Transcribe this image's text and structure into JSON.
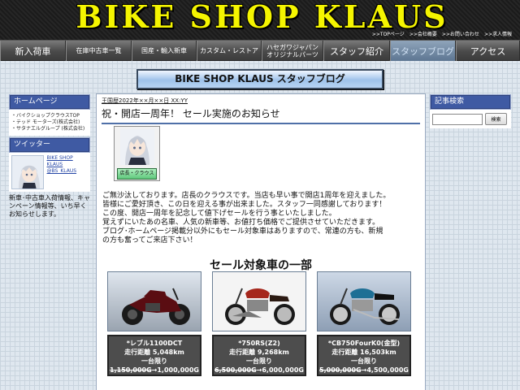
{
  "header": {
    "site_title": "BIKE SHOP KLAUS",
    "util_links": [
      ">>TOPページ",
      ">>会社概要",
      ">>お問い合わせ",
      ">>求人情報"
    ]
  },
  "nav": {
    "items": [
      "新入荷車",
      "在庫中古車一覧",
      "国産・輸入新車",
      "カスタム・レストア",
      "ハセガワジャパン\nオリジナルパーツ",
      "スタッフ紹介",
      "スタッフブログ",
      "アクセス"
    ],
    "active_index": 6
  },
  "page_heading": "BIKE SHOP KLAUS スタッフブログ",
  "left_sidebar": {
    "home_title": "ホームページ",
    "home_links": [
      "・バイクショップクラウスTOP",
      "・テッド モーターズ(株式会社)",
      "・サタナエルグループ (株式会社)"
    ],
    "twitter_title": "ツイッター",
    "twitter_name": "BIKE SHOP KLAUS",
    "twitter_handle": "@BS_KLAUS",
    "description": "新車･中古車入荷情報、キャンペーン情報等、いち早くお知らせします。"
  },
  "right_sidebar": {
    "search_title": "記事検索",
    "search_value": "",
    "search_button": "検索"
  },
  "post": {
    "date": "王国歴2022年××月××日 XX:YY",
    "title": "祝・開店一周年！ セール実施のお知らせ",
    "author_label": "店長・クラウス",
    "body": [
      "ご無沙汰しております。店長のクラウスです。当店も早い事で開店1周年を迎えました。",
      "皆様にご愛好頂き、この日を迎える事が出来ました。スタッフ一同感謝しております！",
      "この度、開店一周年を記念して値下げセールを行う事といたしました。",
      "覚えずにいたあの名車、人気の新車等、お値打ち価格でご提供させていただきます。",
      "ブログ･ホームページ掲載分以外にもセール対象車はありますので、常連の方も、新規",
      "の方も奮ってご来店下さい！"
    ],
    "sale_title": "セール対象車の一部",
    "bikes": [
      {
        "name": "*レブル1100DCT",
        "mileage": "走行距離 5,048km",
        "note": "一台限り",
        "old_price": "1,150,000G",
        "new_price": "1,000,000G",
        "color": "#5a0d12"
      },
      {
        "name": "*750RS(Z2)",
        "mileage": "走行距離 9,268km",
        "note": "一台限り",
        "old_price": "6,500,000G",
        "new_price": "6,000,000G",
        "color": "#a5271c"
      },
      {
        "name": "*CB750FourK0(金型)",
        "mileage": "走行距離 16,503km",
        "note": "一台限り",
        "old_price": "5,000,000G",
        "new_price": "4,500,000G",
        "color": "#1e6f95"
      }
    ]
  }
}
